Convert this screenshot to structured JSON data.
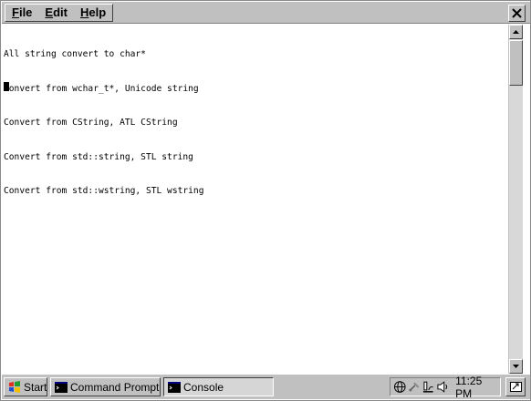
{
  "menu": {
    "items": [
      {
        "accel": "F",
        "rest": "ile"
      },
      {
        "accel": "E",
        "rest": "dit"
      },
      {
        "accel": "H",
        "rest": "elp"
      }
    ]
  },
  "console": {
    "lines": [
      "All string convert to char*",
      "Convert from wchar_t*, Unicode string",
      "Convert from CString, ATL CString",
      "Convert from std::string, STL string",
      "Convert from std::wstring, STL wstring"
    ]
  },
  "taskbar": {
    "start_label": "Start",
    "tasks": [
      {
        "label": "Command Prompt",
        "active": false
      },
      {
        "label": "Console",
        "active": true
      }
    ],
    "clock": "11:25 PM"
  },
  "icons": {
    "close": "close-icon",
    "start": "windows-logo-icon",
    "tray": [
      "network-globe-icon",
      "satellite-icon",
      "connection-icon",
      "volume-icon"
    ],
    "desktop": "show-desktop-icon"
  }
}
